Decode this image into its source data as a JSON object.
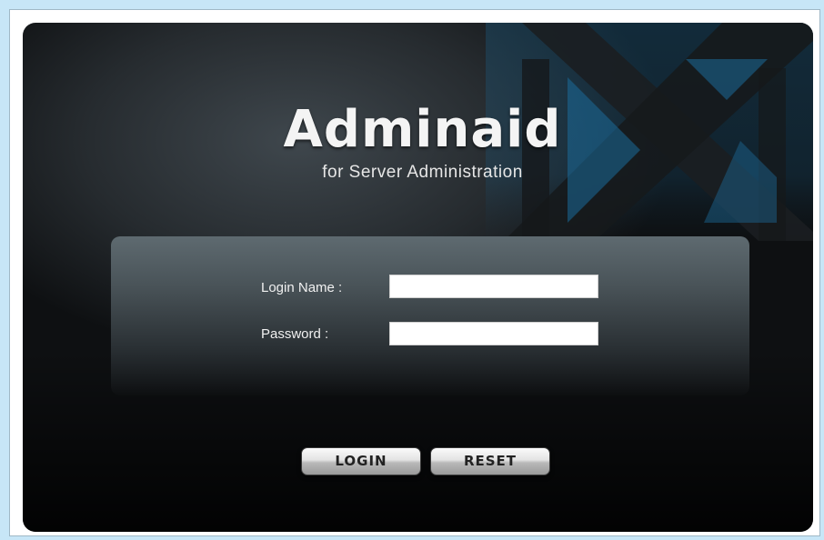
{
  "app": {
    "title": "Adminaid",
    "subtitle": "for Server Administration"
  },
  "form": {
    "login_name_label": "Login Name :",
    "login_name_value": "",
    "password_label": "Password :",
    "password_value": ""
  },
  "buttons": {
    "login_label": "LOGIN",
    "reset_label": "RESET"
  },
  "colors": {
    "page_background": "#c7e6f7",
    "panel_background": "#0b0c0e",
    "accent_blue": "#1c6b9a",
    "button_face": "#d8d8d8"
  }
}
